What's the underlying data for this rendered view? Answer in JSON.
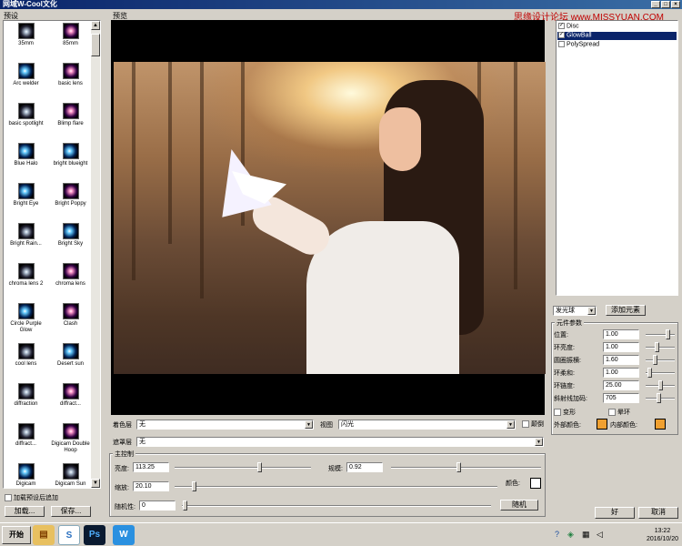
{
  "window": {
    "title": "网域W-Cool文化",
    "min": "_",
    "max": "□",
    "close": "×",
    "watermark": "思缘设计论坛 www.MISSYUAN.COM"
  },
  "presets": {
    "label": "预设",
    "items": [
      {
        "name": "35mm",
        "icon": "lens-flare-thumb"
      },
      {
        "name": "85mm",
        "icon": "lens-flare-thumb"
      },
      {
        "name": "Arc welder",
        "icon": "lens-flare-thumb"
      },
      {
        "name": "basic lens",
        "icon": "lens-flare-thumb"
      },
      {
        "name": "basic spotlight",
        "icon": "lens-flare-thumb"
      },
      {
        "name": "Blimp flare",
        "icon": "lens-flare-thumb"
      },
      {
        "name": "Blue Halo",
        "icon": "lens-flare-thumb"
      },
      {
        "name": "bright blueight",
        "icon": "lens-flare-thumb"
      },
      {
        "name": "Bright Eye",
        "icon": "lens-flare-thumb"
      },
      {
        "name": "Bright Poppy",
        "icon": "lens-flare-thumb"
      },
      {
        "name": "Bright Rain...",
        "icon": "lens-flare-thumb"
      },
      {
        "name": "Bright Sky",
        "icon": "lens-flare-thumb"
      },
      {
        "name": "chroma lens 2",
        "icon": "lens-flare-thumb"
      },
      {
        "name": "chroma lens",
        "icon": "lens-flare-thumb"
      },
      {
        "name": "Circle Purple Glow",
        "icon": "lens-flare-thumb"
      },
      {
        "name": "Clash",
        "icon": "lens-flare-thumb"
      },
      {
        "name": "cool lens",
        "icon": "lens-flare-thumb"
      },
      {
        "name": "Desert sun",
        "icon": "lens-flare-thumb"
      },
      {
        "name": "diffraction",
        "icon": "lens-flare-thumb"
      },
      {
        "name": "diffract...",
        "icon": "lens-flare-thumb"
      },
      {
        "name": "diffract...",
        "icon": "lens-flare-thumb"
      },
      {
        "name": "Digicam Double Hoop",
        "icon": "lens-flare-thumb"
      },
      {
        "name": "Digicam",
        "icon": "lens-flare-thumb"
      },
      {
        "name": "Digicam Sun",
        "icon": "lens-flare-thumb"
      }
    ],
    "add_on_load_label": "加载预设后追加",
    "load_button": "加载...",
    "save_button": "保存..."
  },
  "preview": {
    "label": "预览"
  },
  "layers": {
    "color_layer_label": "着色层",
    "color_layer_value": "无",
    "mask_layer_label": "遮罩层",
    "mask_layer_value": "无",
    "view_label": "视图",
    "view_value": "闪光",
    "invert_label": "颠倒"
  },
  "main_control": {
    "title": "主控制",
    "brightness_label": "亮度:",
    "brightness_value": "113.25",
    "scale_label": "规模:",
    "scale_value": "0.92",
    "zoom_label": "缩放:",
    "zoom_value": "20.10",
    "color_label": "颜色:",
    "random_label": "随机性:",
    "random_value": "0",
    "random_button": "随机"
  },
  "element_list": {
    "items": [
      {
        "label": "Disc",
        "selected": false,
        "checked": true
      },
      {
        "label": "GlowBall",
        "selected": true,
        "checked": true
      },
      {
        "label": "PolySpread",
        "selected": false,
        "checked": false
      }
    ]
  },
  "element_add": {
    "type_value": "发光球",
    "add_button": "添加元素"
  },
  "element_params": {
    "title": "元件参数",
    "rows": [
      {
        "label": "位置:",
        "value": "1.00"
      },
      {
        "label": "环亮度:",
        "value": "1.00"
      },
      {
        "label": "圆圈振横:",
        "value": "1.60"
      },
      {
        "label": "环柔和:",
        "value": "1.00"
      },
      {
        "label": "环链度:",
        "value": "25.00"
      },
      {
        "label": "斜射线加码:",
        "value": "705"
      }
    ],
    "deform_label": "变形",
    "halo_label": "晕环",
    "outer_color_label": "外部颜色:",
    "inner_color_label": "内部颜色:",
    "outer_color": "#f0a030",
    "inner_color": "#f0a030"
  },
  "dialog_buttons": {
    "ok": "好",
    "cancel": "取消"
  },
  "taskbar": {
    "start_label": "开始",
    "apps": [
      "explorer-icon",
      "browser-icon",
      "photoshop-icon",
      "w-app-icon"
    ],
    "ps_label": "Ps",
    "w_label": "W",
    "time": "13:22",
    "date": "2016/10/20"
  }
}
